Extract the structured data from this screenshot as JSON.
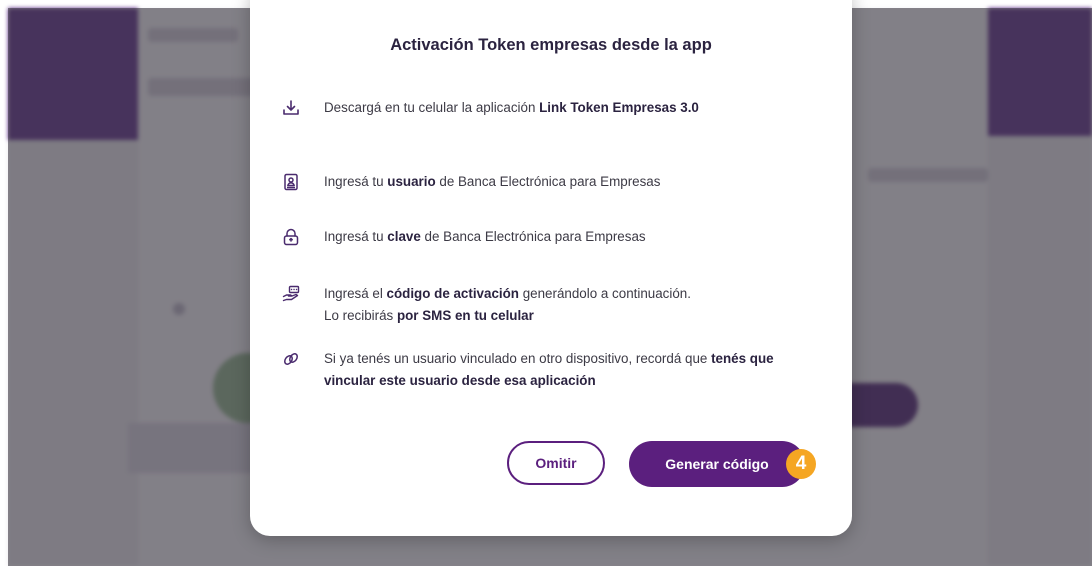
{
  "modal": {
    "title": "Activación Token empresas desde la app",
    "steps": [
      {
        "icon": "download-icon",
        "pre": "Descargá en tu celular la aplicación ",
        "bold": "Link Token Empresas 3.0",
        "post": ""
      },
      {
        "icon": "id-badge-icon",
        "pre": "Ingresá tu ",
        "bold": "usuario",
        "post": " de Banca Electrónica para Empresas"
      },
      {
        "icon": "lock-icon",
        "pre": "Ingresá tu ",
        "bold": "clave",
        "post": " de Banca Electrónica para Empresas"
      },
      {
        "icon": "hand-code-icon",
        "pre": "Ingresá el ",
        "bold": "código de activación",
        "post": " generándolo a continuación.",
        "pre2": "Lo recibirás ",
        "bold2": "por SMS en tu celular"
      },
      {
        "icon": "link-icon",
        "pre": "Si ya tenés un usuario vinculado en otro dispositivo, recordá que ",
        "bold": "tenés que vincular este usuario desde esa aplicación",
        "post": ""
      }
    ],
    "buttons": {
      "omit_label": "Omitir",
      "generate_label": "Generar código"
    },
    "step_badge": "4"
  },
  "colors": {
    "accent": "#5b1f7e",
    "badge": "#f5a623",
    "background_band": "#5b2a86"
  }
}
